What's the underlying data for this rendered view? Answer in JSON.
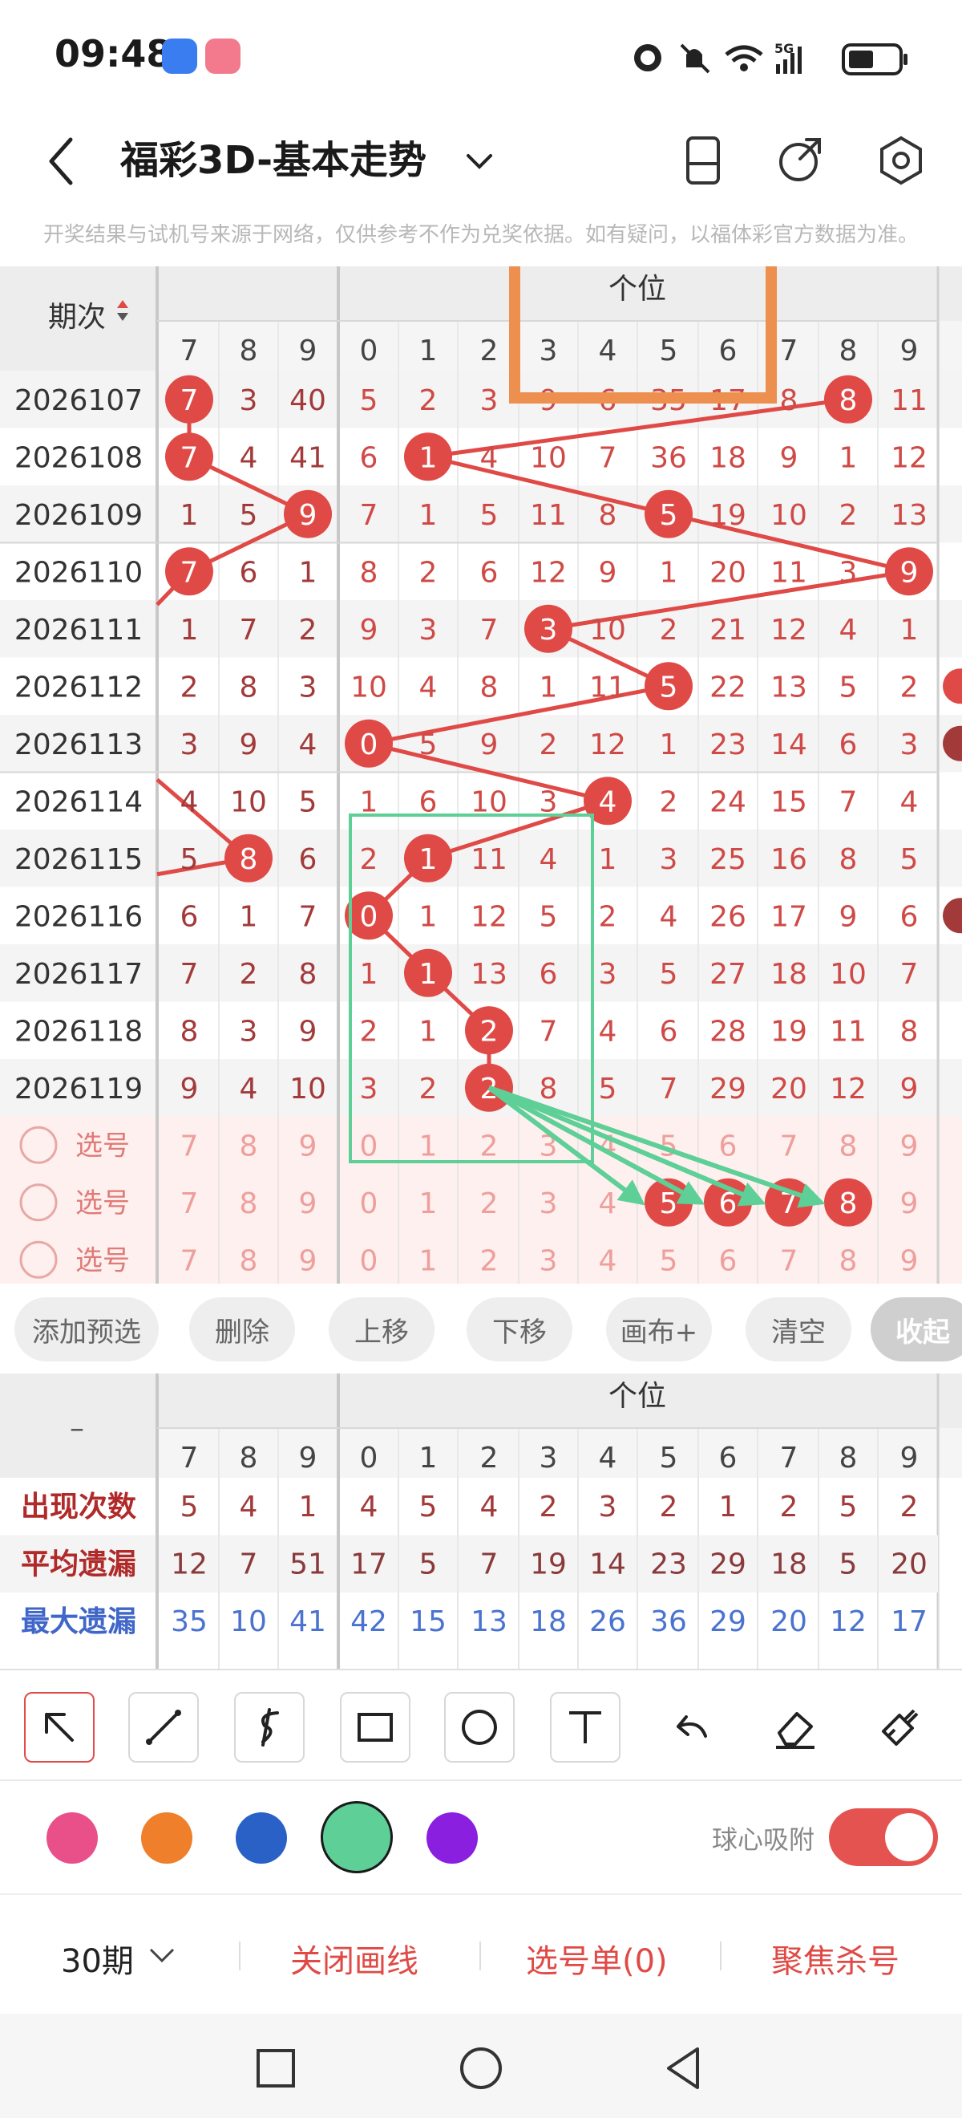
{
  "status_bar": {
    "time": "09:48",
    "network": "5G"
  },
  "header": {
    "title": "福彩3D-基本走势"
  },
  "notice": "开奖结果与试机号来源于网络，仅供参考不作为兑奖依据。如有疑问，以福体彩官方数据为准。",
  "table": {
    "period_header": "期次",
    "group_header": "个位",
    "col_headers": [
      "7",
      "8",
      "9",
      "0",
      "1",
      "2",
      "3",
      "4",
      "5",
      "6",
      "7",
      "8",
      "9"
    ],
    "rows": [
      {
        "period": "2026107",
        "cells": [
          "7",
          "3",
          "40",
          "5",
          "2",
          "3",
          "9",
          "6",
          "35",
          "17",
          "8",
          "8",
          "11"
        ]
      },
      {
        "period": "2026108",
        "cells": [
          "7",
          "4",
          "41",
          "6",
          "1",
          "4",
          "10",
          "7",
          "36",
          "18",
          "9",
          "1",
          "12"
        ]
      },
      {
        "period": "2026109",
        "cells": [
          "1",
          "5",
          "9",
          "7",
          "1",
          "5",
          "11",
          "8",
          "5",
          "19",
          "10",
          "2",
          "13"
        ]
      },
      {
        "period": "2026110",
        "cells": [
          "7",
          "6",
          "1",
          "8",
          "2",
          "6",
          "12",
          "9",
          "1",
          "20",
          "11",
          "3",
          "9"
        ]
      },
      {
        "period": "2026111",
        "cells": [
          "1",
          "7",
          "2",
          "9",
          "3",
          "7",
          "3",
          "10",
          "2",
          "21",
          "12",
          "4",
          "1"
        ]
      },
      {
        "period": "2026112",
        "cells": [
          "2",
          "8",
          "3",
          "10",
          "4",
          "8",
          "1",
          "11",
          "5",
          "22",
          "13",
          "5",
          "2"
        ]
      },
      {
        "period": "2026113",
        "cells": [
          "3",
          "9",
          "4",
          "0",
          "5",
          "9",
          "2",
          "12",
          "1",
          "23",
          "14",
          "6",
          "3"
        ]
      },
      {
        "period": "2026114",
        "cells": [
          "4",
          "10",
          "5",
          "1",
          "6",
          "10",
          "3",
          "4",
          "2",
          "24",
          "15",
          "7",
          "4"
        ]
      },
      {
        "period": "2026115",
        "cells": [
          "5",
          "8",
          "6",
          "2",
          "1",
          "11",
          "4",
          "1",
          "3",
          "25",
          "16",
          "8",
          "5"
        ]
      },
      {
        "period": "2026116",
        "cells": [
          "6",
          "1",
          "7",
          "0",
          "1",
          "12",
          "5",
          "2",
          "4",
          "26",
          "17",
          "9",
          "6"
        ]
      },
      {
        "period": "2026117",
        "cells": [
          "7",
          "2",
          "8",
          "1",
          "1",
          "13",
          "6",
          "3",
          "5",
          "27",
          "18",
          "10",
          "7"
        ]
      },
      {
        "period": "2026118",
        "cells": [
          "8",
          "3",
          "9",
          "2",
          "1",
          "2",
          "7",
          "4",
          "6",
          "28",
          "19",
          "11",
          "8"
        ]
      },
      {
        "period": "2026119",
        "cells": [
          "9",
          "4",
          "10",
          "3",
          "2",
          "2",
          "8",
          "5",
          "7",
          "29",
          "20",
          "12",
          "9"
        ]
      }
    ],
    "pick_rows": [
      {
        "label": "选号",
        "cells": [
          "7",
          "8",
          "9",
          "0",
          "1",
          "2",
          "3",
          "4",
          "5",
          "6",
          "7",
          "8",
          "9"
        ]
      },
      {
        "label": "选号",
        "cells": [
          "7",
          "8",
          "9",
          "0",
          "1",
          "2",
          "3",
          "4",
          "5",
          "6",
          "7",
          "8",
          "9"
        ]
      },
      {
        "label": "选号",
        "cells": [
          "7",
          "8",
          "9",
          "0",
          "1",
          "2",
          "3",
          "4",
          "5",
          "6",
          "7",
          "8",
          "9"
        ]
      }
    ]
  },
  "actions": [
    "添加预选",
    "删除",
    "上移",
    "下移",
    "画布+",
    "清空",
    "收起"
  ],
  "stats": {
    "dash": "–",
    "group_header": "个位",
    "col_headers": [
      "7",
      "8",
      "9",
      "0",
      "1",
      "2",
      "3",
      "4",
      "5",
      "6",
      "7",
      "8",
      "9"
    ],
    "rows": [
      {
        "label": "出现次数",
        "values": [
          "5",
          "4",
          "1",
          "4",
          "5",
          "4",
          "2",
          "3",
          "2",
          "1",
          "2",
          "5",
          "2"
        ]
      },
      {
        "label": "平均遗漏",
        "values": [
          "12",
          "7",
          "51",
          "17",
          "5",
          "7",
          "19",
          "14",
          "23",
          "29",
          "18",
          "5",
          "20"
        ]
      },
      {
        "label": "最大遗漏",
        "values": [
          "35",
          "10",
          "41",
          "42",
          "15",
          "13",
          "18",
          "26",
          "36",
          "29",
          "20",
          "12",
          "17"
        ]
      }
    ]
  },
  "draw_tools": [
    "arrow-tool-icon",
    "line-tool-icon",
    "curve-tool-icon",
    "rectangle-tool-icon",
    "circle-tool-icon",
    "text-tool-icon",
    "undo-icon",
    "eraser-icon",
    "brush-icon"
  ],
  "colors": [
    "#e9508a",
    "#ef7f2a",
    "#2961c7",
    "#5dcf97",
    "#8b1fe0"
  ],
  "snap": {
    "label": "球心吸附",
    "on": true
  },
  "bottom": {
    "periods": "30期",
    "close_lines": "关闭画线",
    "pick_list": "选号单(0)",
    "focus": "聚焦杀号"
  }
}
